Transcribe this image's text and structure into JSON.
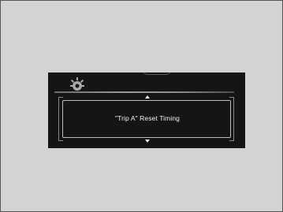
{
  "display": {
    "setting_label": "\"Trip A\" Reset Timing"
  },
  "icons": {
    "settings": "gear-icon",
    "scroll_up": "arrow-up-icon",
    "scroll_down": "arrow-down-icon"
  },
  "colors": {
    "background": "#d3d3d3",
    "screen": "#151515",
    "text": "#f2f2f2",
    "frame": "#bdbdbd"
  }
}
